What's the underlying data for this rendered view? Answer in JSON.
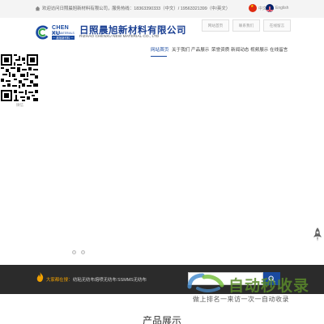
{
  "topbar": {
    "welcome": "欢迎访问日照晨旭新材料有限公司，服务热线：18363390333（中文）/ 19563321399（中/英文）",
    "languages": [
      "中文",
      "English"
    ]
  },
  "header": {
    "tabs": [
      "网站首页",
      "联系我们",
      "在线留言"
    ],
    "logo_en": "CHEN XU",
    "logo_sub": "NEW MATERIALS",
    "logo_cn": "一 晨旭新材料 一",
    "company_cn": "日照晨旭新材料有限公司",
    "company_en": "RIZHAO CHENXU NEW MATERIAL CO., LTD"
  },
  "nav": {
    "items": [
      "网站首页",
      "关于我们",
      "产品展示",
      "荣誉资质",
      "新闻动态",
      "视频展示",
      "在线留言"
    ],
    "active_index": 0
  },
  "qr": {
    "caption": "微信"
  },
  "search": {
    "label": "大家都在搜：",
    "keywords": [
      "纺粘无纺布",
      "熔喷无纺布",
      "SSMMS无纺布"
    ],
    "placeholder": ""
  },
  "watermark": {
    "title": "自动秒收录",
    "subtitle": "做上排名一来访一次一自动收录"
  },
  "section": {
    "title": "产品展示"
  },
  "colors": {
    "brand": "#1a4aa0",
    "accent": "#f0a000",
    "dark_bar": "#2b2b2b"
  },
  "icons": [
    "home-icon",
    "china-flag-icon",
    "uk-flag-icon",
    "rocket-icon",
    "fire-icon",
    "search-icon"
  ]
}
